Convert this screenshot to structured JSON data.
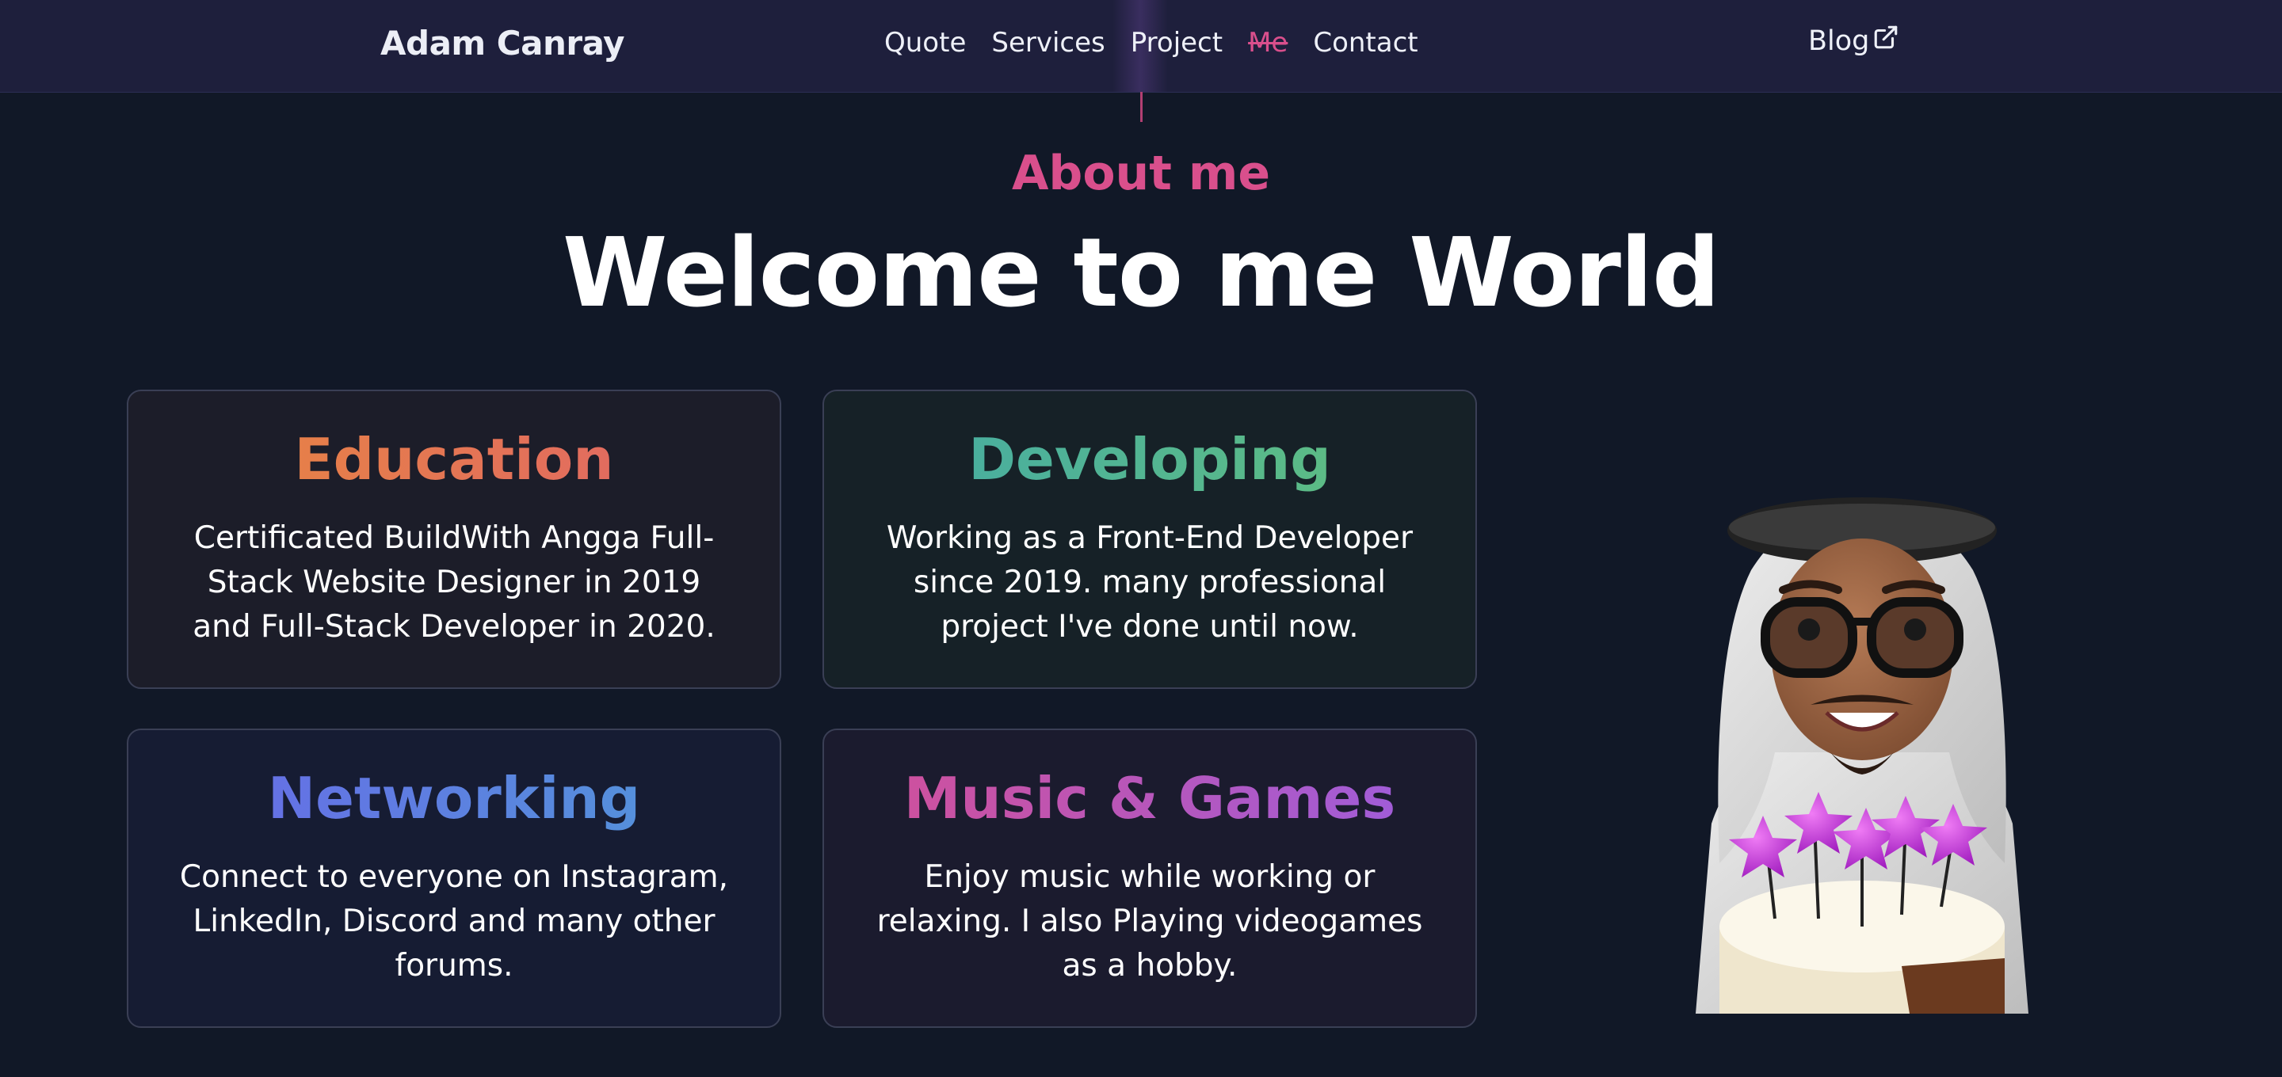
{
  "header": {
    "brand": "Adam Canray",
    "nav": [
      "Quote",
      "Services",
      "Project",
      "Me",
      "Contact"
    ],
    "active": "Me",
    "blog_label": "Blog"
  },
  "about": {
    "eyebrow": "About me",
    "headline": "Welcome to me World"
  },
  "cards": [
    {
      "title": "Education",
      "text": "Certificated BuildWith Angga Full-Stack Website Designer in 2019 and Full-Stack Developer in 2020."
    },
    {
      "title": "Developing",
      "text": "Working as a Front-End Developer since 2019. many professional project I've done until now."
    },
    {
      "title": "Networking",
      "text": "Connect to everyone on Instagram, LinkedIn, Discord and many other forums."
    },
    {
      "title": "Music & Games",
      "text": "Enjoy music while working or relaxing. I also Playing videogames as a hobby."
    }
  ],
  "colors": {
    "background": "#111827",
    "header": "#1e1f3c",
    "accent": "#d94f8c"
  },
  "icons": {
    "blog": "external-link-icon"
  }
}
